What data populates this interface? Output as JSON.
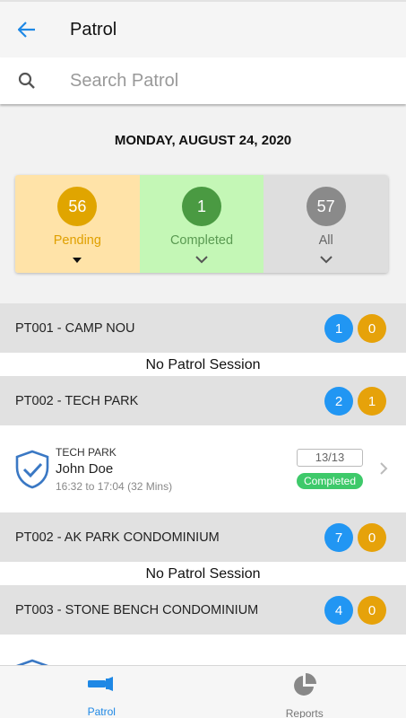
{
  "header": {
    "title": "Patrol"
  },
  "search": {
    "placeholder": "Search Patrol",
    "value": ""
  },
  "date": "MONDAY, AUGUST 24, 2020",
  "summary": [
    {
      "count": "56",
      "label": "Pending",
      "bg": "#ffe3a8",
      "circle": "#e0a500",
      "text": "#e0a000",
      "chevron_icon": "caret-down-icon"
    },
    {
      "count": "1",
      "label": "Completed",
      "bg": "#c4f7b6",
      "circle": "#4a9a42",
      "text": "#5a9a52",
      "chevron_icon": "chevron-down-icon"
    },
    {
      "count": "57",
      "label": "All",
      "bg": "#dedede",
      "circle": "#8a8a8a",
      "text": "#666666",
      "chevron_icon": "chevron-down-icon"
    }
  ],
  "groups": [
    {
      "title": "PT001 - CAMP NOU",
      "blue": "1",
      "orange": "0",
      "empty_text": "No Patrol Session"
    },
    {
      "title": "PT002 - TECH PARK",
      "blue": "2",
      "orange": "1",
      "session": {
        "area": "TECH PARK",
        "name": "John Doe",
        "time": "16:32 to 17:04 (32 Mins)",
        "count": "13/13",
        "status": "Completed"
      }
    },
    {
      "title": "PT002 - AK PARK CONDOMINIUM",
      "blue": "7",
      "orange": "0",
      "empty_text": "No Patrol Session"
    },
    {
      "title": "PT003 - STONE BENCH CONDOMINIUM",
      "blue": "4",
      "orange": "0"
    }
  ],
  "tabs": [
    {
      "label": "Patrol",
      "icon": "flashlight-icon",
      "active": true
    },
    {
      "label": "Reports",
      "icon": "pie-chart-icon",
      "active": false
    }
  ],
  "colors": {
    "accent": "#1e88e5",
    "badge_blue": "#2196f3",
    "badge_orange": "#e6a20a",
    "completed_green": "#3ec96a"
  }
}
